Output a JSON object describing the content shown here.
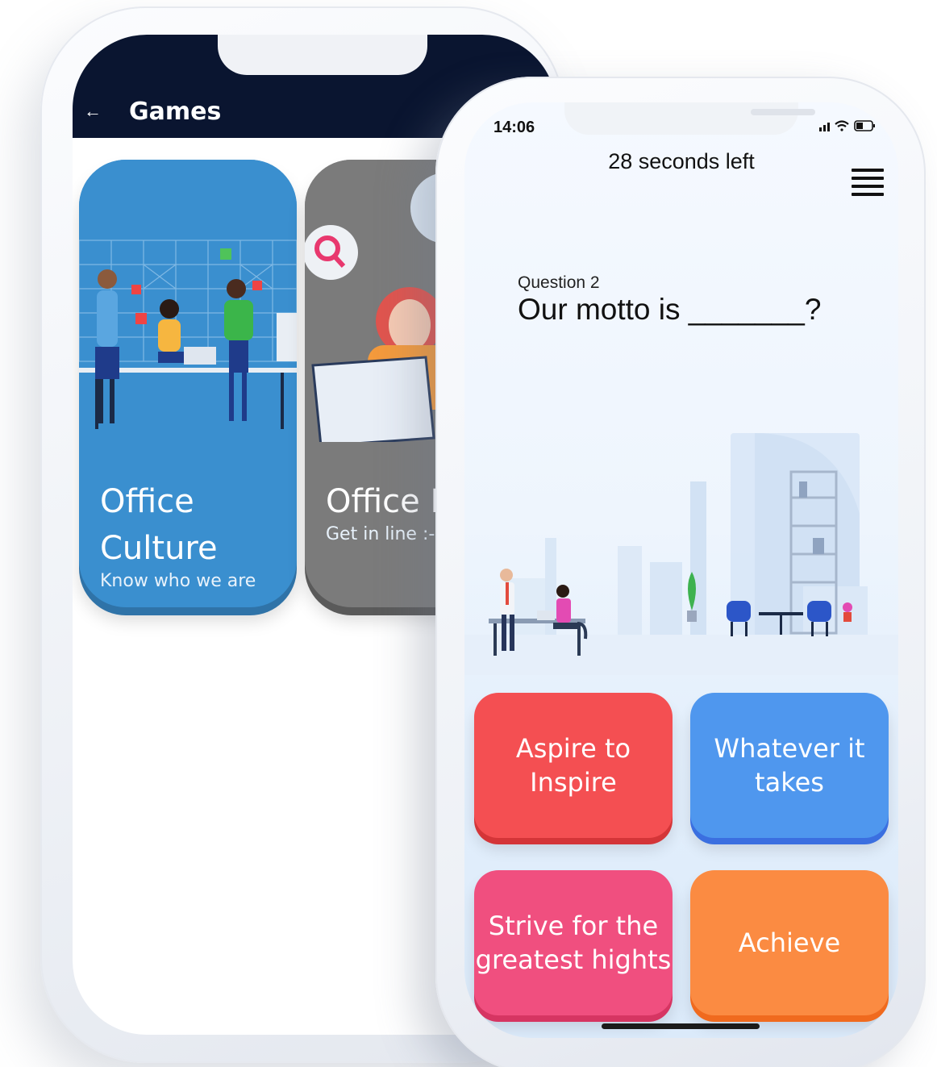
{
  "back_phone": {
    "header": {
      "title": "Games",
      "back_icon": "arrow-left-icon"
    },
    "cards": [
      {
        "title_line1": "Office",
        "title_line2": "Culture",
        "subtitle": "Know who we are",
        "color": "#3a8fcf"
      },
      {
        "title_line1": "Office L",
        "subtitle": "Get in line :-",
        "color": "#7b7b7b"
      }
    ]
  },
  "front_phone": {
    "status": {
      "time": "14:06",
      "icons": [
        "signal-icon",
        "wifi-icon",
        "battery-icon"
      ]
    },
    "timer_text": "28 seconds left",
    "menu_icon": "hamburger-menu-icon",
    "question": {
      "label": "Question 2",
      "text": "Our motto is _______?"
    },
    "answers": [
      {
        "label": "Aspire to Inspire",
        "color": "#f44f52"
      },
      {
        "label": "Whatever it takes",
        "color": "#4f97ee"
      },
      {
        "label": "Strive for the greatest hights",
        "color": "#f04f7f"
      },
      {
        "label": "Achieve",
        "color": "#fb8b42"
      }
    ]
  }
}
